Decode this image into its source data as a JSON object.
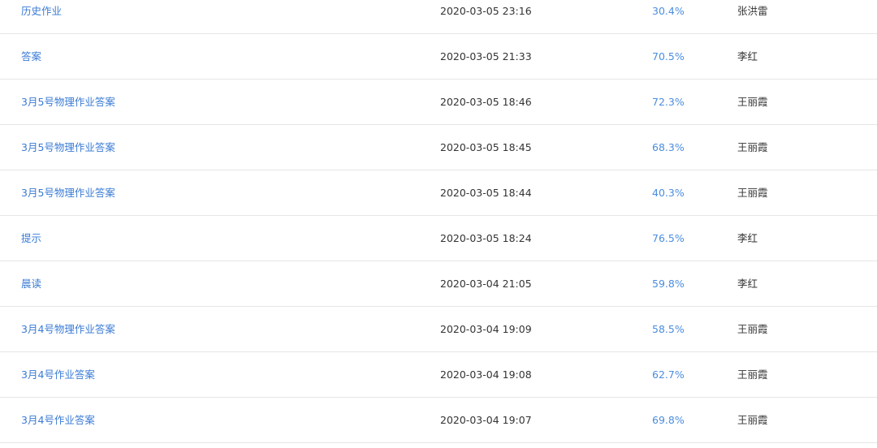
{
  "table": {
    "rows": [
      {
        "title": "历史作业",
        "time": "2020-03-05 23:16",
        "rate": "30.4%",
        "author": "张洪雷"
      },
      {
        "title": "答案",
        "time": "2020-03-05 21:33",
        "rate": "70.5%",
        "author": "李红"
      },
      {
        "title": "3月5号物理作业答案",
        "time": "2020-03-05 18:46",
        "rate": "72.3%",
        "author": "王丽霞"
      },
      {
        "title": "3月5号物理作业答案",
        "time": "2020-03-05 18:45",
        "rate": "68.3%",
        "author": "王丽霞"
      },
      {
        "title": "3月5号物理作业答案",
        "time": "2020-03-05 18:44",
        "rate": "40.3%",
        "author": "王丽霞"
      },
      {
        "title": "提示",
        "time": "2020-03-05 18:24",
        "rate": "76.5%",
        "author": "李红"
      },
      {
        "title": "晨读",
        "time": "2020-03-04 21:05",
        "rate": "59.8%",
        "author": "李红"
      },
      {
        "title": "3月4号物理作业答案",
        "time": "2020-03-04 19:09",
        "rate": "58.5%",
        "author": "王丽霞"
      },
      {
        "title": "3月4号作业答案",
        "time": "2020-03-04 19:08",
        "rate": "62.7%",
        "author": "王丽霞"
      },
      {
        "title": "3月4号作业答案",
        "time": "2020-03-04 19:07",
        "rate": "69.8%",
        "author": "王丽霞"
      }
    ]
  },
  "colors": {
    "link": "#3a7bd5",
    "rate": "#4a8de0",
    "text": "#333333",
    "divider": "#e6e6e6"
  }
}
